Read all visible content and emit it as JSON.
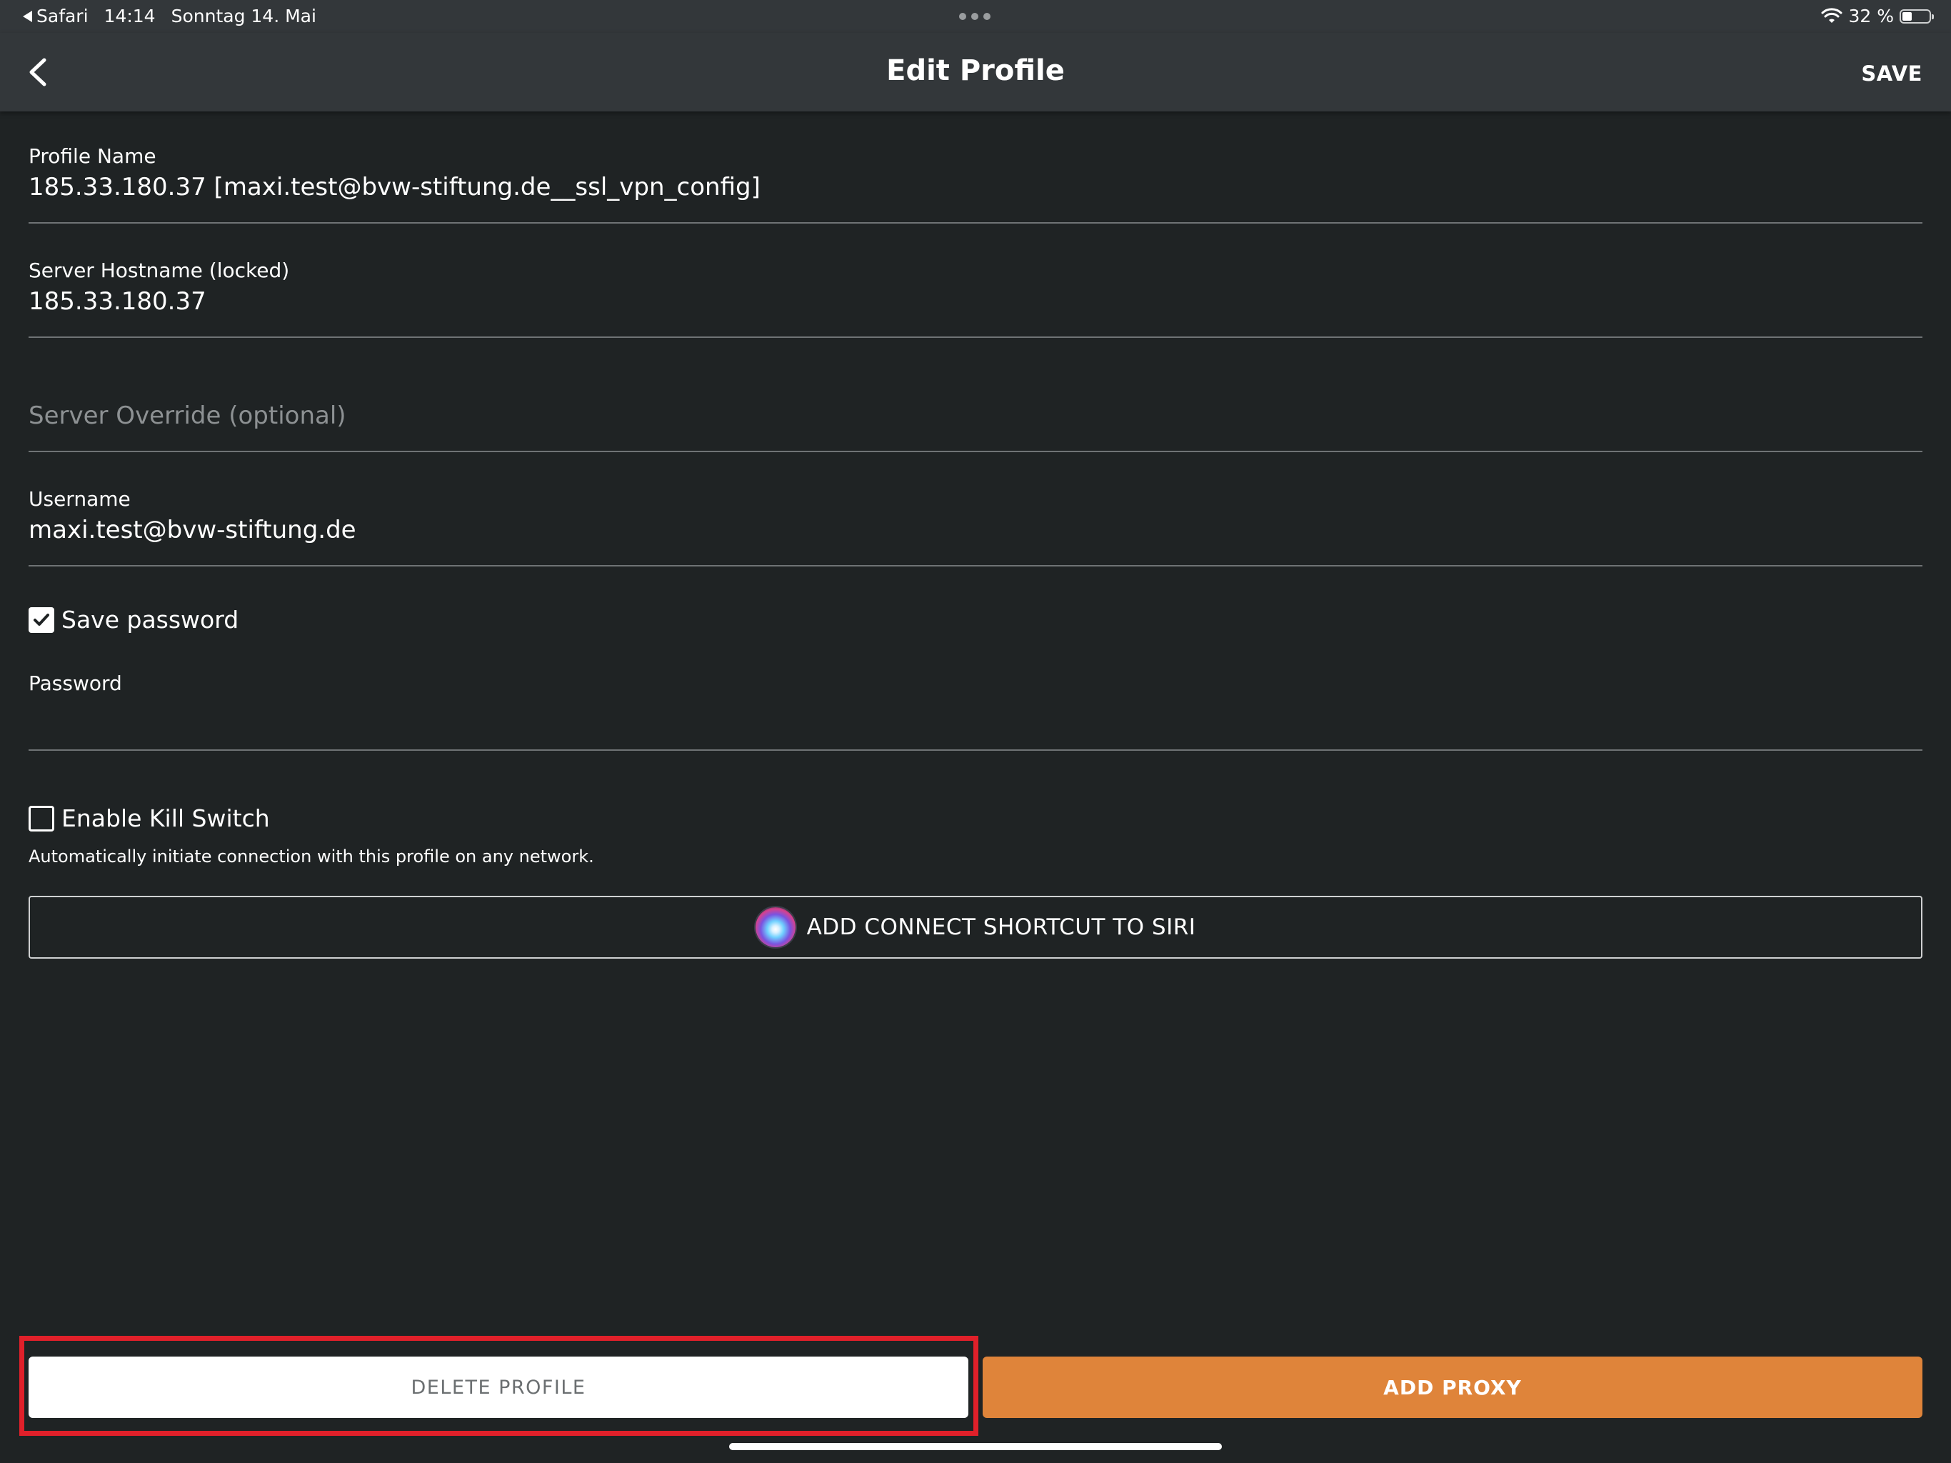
{
  "status_bar": {
    "back_app": "Safari",
    "time": "14:14",
    "date": "Sonntag 14. Mai",
    "battery_text": "32 %",
    "battery_level": 0.32
  },
  "nav": {
    "title": "Edit Profile",
    "save_label": "SAVE",
    "back_icon": "chevron-left-icon"
  },
  "form": {
    "profile_name": {
      "label": "Profile Name",
      "value": "185.33.180.37 [maxi.test@bvw-stiftung.de__ssl_vpn_config]"
    },
    "server_hostname": {
      "label": "Server Hostname (locked)",
      "value": "185.33.180.37"
    },
    "server_override": {
      "placeholder": "Server Override (optional)",
      "value": ""
    },
    "username": {
      "label": "Username",
      "value": "maxi.test@bvw-stiftung.de"
    },
    "save_password": {
      "label": "Save password",
      "checked": true
    },
    "password": {
      "label": "Password",
      "value": ""
    },
    "kill_switch": {
      "label": "Enable Kill Switch",
      "checked": false,
      "helper": "Automatically initiate connection with this profile on any network."
    },
    "siri_button": {
      "label": "ADD CONNECT SHORTCUT TO SIRI",
      "icon": "siri-icon"
    }
  },
  "actions": {
    "delete_label": "DELETE PROFILE",
    "add_proxy_label": "ADD PROXY",
    "accent_color": "#df843a",
    "highlight_color": "#e0202a"
  }
}
